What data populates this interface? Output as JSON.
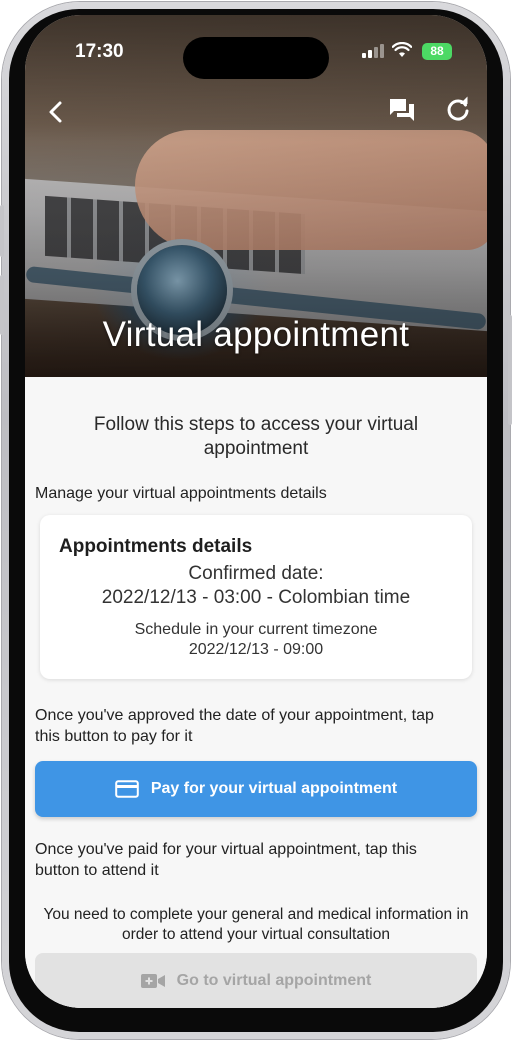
{
  "status_bar": {
    "time": "17:30",
    "battery": "88"
  },
  "header": {
    "title": "Virtual appointment",
    "back_icon": "chevron-left-icon",
    "chat_icon": "chat-bubbles-icon",
    "refresh_icon": "refresh-icon"
  },
  "main": {
    "intro": "Follow this steps to access your virtual appointment",
    "manage_label": "Manage your virtual appointments details",
    "details_card": {
      "title": "Appointments details",
      "confirmed_label": "Confirmed date:",
      "confirmed_value": "2022/12/13 - 03:00 - Colombian time",
      "schedule_label": "Schedule in your current timezone",
      "schedule_value": "2022/12/13 - 09:00"
    },
    "pay_instruction": "Once you've approved the date of your appointment, tap this button to pay for it",
    "pay_button": {
      "label": "Pay for your virtual appointment",
      "icon": "credit-card-icon"
    },
    "attend_instruction": "Once you've paid for your virtual appointment, tap this button to attend it",
    "requirement_note": "You need to complete your general and medical information in order to attend your virtual consultation",
    "go_button": {
      "label": "Go to virtual appointment",
      "icon": "video-camera-icon",
      "enabled": false
    }
  },
  "colors": {
    "accent": "#3f95e5",
    "disabled_bg": "#e2e2e2",
    "disabled_text": "#a5a5a5",
    "battery": "#4cd964"
  }
}
